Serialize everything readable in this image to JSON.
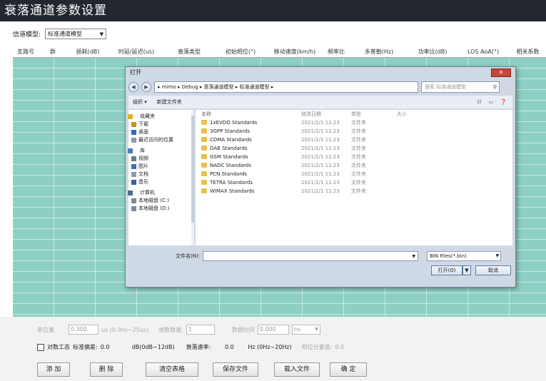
{
  "window": {
    "title": "衰落通道参数设置"
  },
  "model": {
    "label": "信道模型:",
    "value": "标准通道模型"
  },
  "table": {
    "columns": [
      "支路号",
      "群",
      "损耗(dB)",
      "时延/延迟(us)",
      "衰落类型",
      "初始相位(°)",
      "移动速度(km/h)",
      "频率比",
      "多普勒(Hz)",
      "功率比(dB)",
      "LOS AoA(°)",
      "相关系数"
    ]
  },
  "bottom": {
    "unit_label": "单位量",
    "unit_value": "0.300",
    "unit_range": "us (0.3ns~25us)",
    "count_label": "帧数数量:",
    "count_value": "1",
    "time_label": "数据时间",
    "time_value": "0.000",
    "time_unit": "ns",
    "log_label": "对数工态",
    "std_label": "标准偏差:",
    "std_value": "0.0",
    "std_unit": "dB(0dB~12dB)",
    "rate_label": "衰落速率:",
    "rate_value": "0.0",
    "rate_unit": "Hz (0Hz~20Hz)",
    "corr_label": "相位分量值:",
    "corr_value": "0.0"
  },
  "buttons": {
    "add": "添 加",
    "delete": "删 除",
    "clear": "清空表格",
    "save": "保存文件",
    "load": "载入文件",
    "ok": "确 定"
  },
  "dialog": {
    "title": "打开",
    "close": "✕",
    "back": "◀",
    "forward": "▶",
    "path": "▸ mimo ▸ Debug ▸ 衰落通道模型 ▸ 标准通道模型 ▸",
    "search_placeholder": "搜索 标准通道模型",
    "toolbar": {
      "organize": "组织 ▾",
      "new_folder": "新建文件夹"
    },
    "nav": [
      {
        "label": "收藏夹",
        "group": true,
        "icon": "star-icon",
        "color": "#e8b020"
      },
      {
        "label": "下载",
        "group": false,
        "icon": "download-icon",
        "color": "#c8961c"
      },
      {
        "label": "桌面",
        "group": false,
        "icon": "desktop-icon",
        "color": "#3a6ab0"
      },
      {
        "label": "最近访问的位置",
        "group": false,
        "icon": "recent-icon",
        "color": "#8a9ab0"
      },
      {
        "label": "库",
        "group": true,
        "icon": "library-icon",
        "color": "#4a7ac0"
      },
      {
        "label": "视频",
        "group": false,
        "icon": "video-icon",
        "color": "#6a7a90"
      },
      {
        "label": "图片",
        "group": false,
        "icon": "picture-icon",
        "color": "#3a70b0"
      },
      {
        "label": "文档",
        "group": false,
        "icon": "document-icon",
        "color": "#8a9ab0"
      },
      {
        "label": "音乐",
        "group": false,
        "icon": "music-icon",
        "color": "#3a60a0"
      },
      {
        "label": "计算机",
        "group": true,
        "icon": "computer-icon",
        "color": "#4a6a90"
      },
      {
        "label": "本地磁盘 (C:)",
        "group": false,
        "icon": "drive-icon",
        "color": "#7a8a9a"
      },
      {
        "label": "本地磁盘 (D:)",
        "group": false,
        "icon": "drive-icon",
        "color": "#7a8a9a"
      }
    ],
    "headers": {
      "name": "名称",
      "date": "修改日期",
      "type": "类型",
      "size": "大小"
    },
    "files": [
      {
        "name": "1xEVDO Standards",
        "date": "2021/2/1 11:23",
        "type": "文件夹"
      },
      {
        "name": "3GPP Standards",
        "date": "2021/2/1 11:23",
        "type": "文件夹"
      },
      {
        "name": "CDMA Standards",
        "date": "2021/2/1 11:23",
        "type": "文件夹"
      },
      {
        "name": "DAB Standards",
        "date": "2021/2/1 11:23",
        "type": "文件夹"
      },
      {
        "name": "GSM Standards",
        "date": "2021/2/1 11:23",
        "type": "文件夹"
      },
      {
        "name": "NADC Standards",
        "date": "2021/2/1 11:23",
        "type": "文件夹"
      },
      {
        "name": "PCN Standards",
        "date": "2021/2/1 11:23",
        "type": "文件夹"
      },
      {
        "name": "TETRA Standards",
        "date": "2021/2/1 11:23",
        "type": "文件夹"
      },
      {
        "name": "WIMAX Standards",
        "date": "2021/2/1 11:23",
        "type": "文件夹"
      }
    ],
    "filename_label": "文件名(N):",
    "filename_value": "",
    "filter": "BIN Files(*.bin)",
    "open": "打开(O)",
    "cancel": "取消"
  }
}
